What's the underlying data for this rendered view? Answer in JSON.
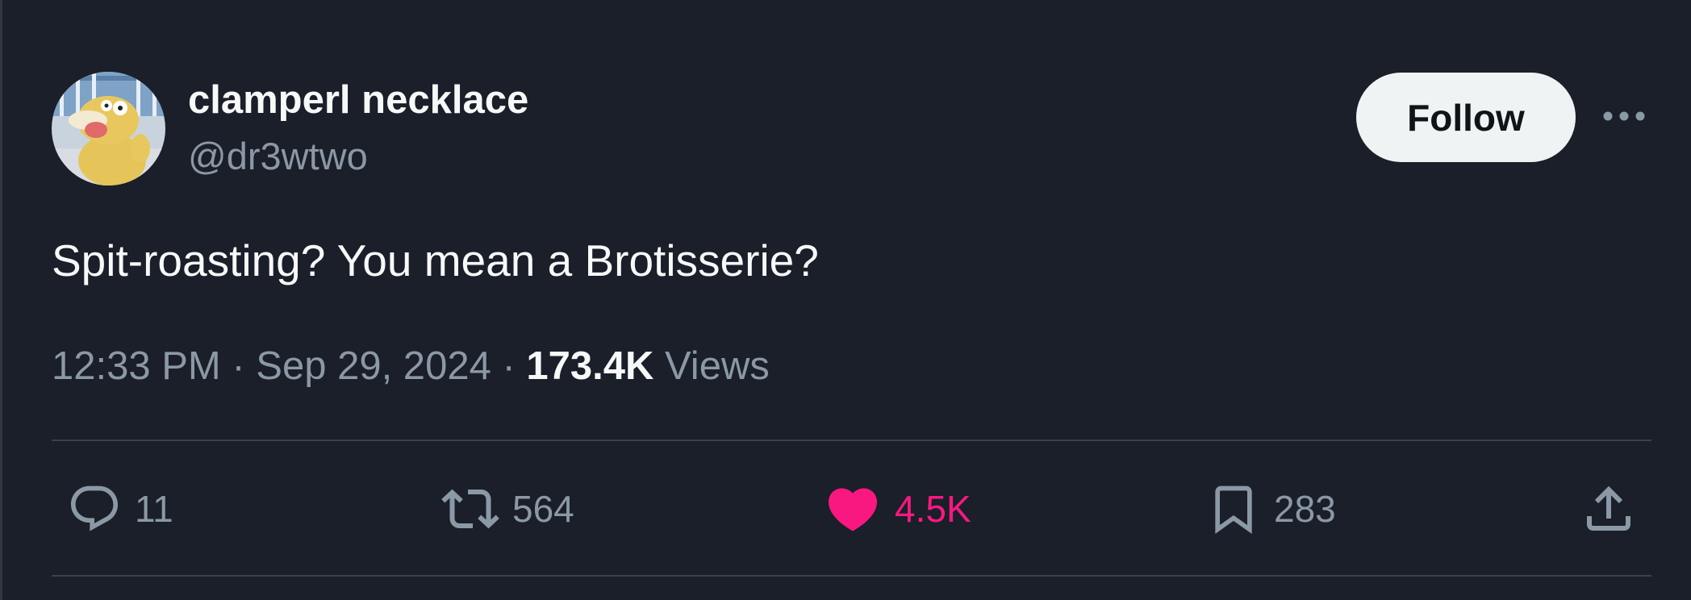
{
  "author": {
    "display_name": "clamperl necklace",
    "handle": "@dr3wtwo",
    "avatar": "psyduck-avatar"
  },
  "follow_button": {
    "label": "Follow"
  },
  "more_menu": {
    "icon": "more-horizontal-icon"
  },
  "tweet": {
    "text": "Spit-roasting? You mean a Brotisserie?",
    "time": "12:33 PM",
    "separator": " · ",
    "date": "Sep 29, 2024",
    "views_count": "173.4K",
    "views_label": " Views"
  },
  "actions": {
    "reply": {
      "icon": "reply-icon",
      "count": "11"
    },
    "retweet": {
      "icon": "retweet-icon",
      "count": "564"
    },
    "like": {
      "icon": "heart-icon",
      "count": "4.5K",
      "liked": true
    },
    "bookmark": {
      "icon": "bookmark-icon",
      "count": "283"
    },
    "share": {
      "icon": "share-icon"
    }
  },
  "colors": {
    "background": "#1a1f29",
    "text_primary": "#f7f9f9",
    "text_secondary": "#8b98a5",
    "like_pink": "#f91880",
    "follow_bg": "#eff3f4",
    "divider": "#38444d"
  }
}
